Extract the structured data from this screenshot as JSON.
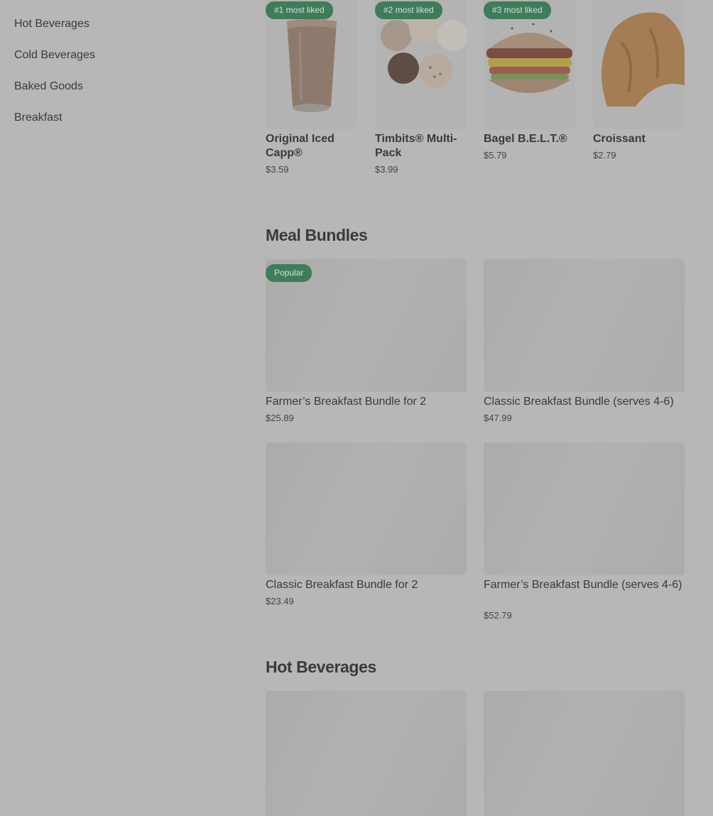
{
  "sidebar": {
    "items": [
      {
        "label": "Hot Beverages"
      },
      {
        "label": "Cold Beverages"
      },
      {
        "label": "Baked Goods"
      },
      {
        "label": "Breakfast"
      }
    ]
  },
  "most_liked": [
    {
      "badge": "#1 most liked",
      "name": "Original Iced Capp®",
      "price": "$3.59",
      "image": "iced-capp-image"
    },
    {
      "badge": "#2 most liked",
      "name": "Timbits® Multi-Pack",
      "price": "$3.99",
      "image": "timbits-image"
    },
    {
      "badge": "#3 most liked",
      "name": "Bagel B.E.L.T.®",
      "price": "$5.79",
      "image": "bagel-belt-image"
    },
    {
      "badge": "",
      "name": "Croissant",
      "price": "$2.79",
      "image": "croissant-image"
    }
  ],
  "meal_bundles": {
    "title": "Meal Bundles",
    "items": [
      {
        "badge": "Popular",
        "name": "Farmer’s Breakfast Bundle for 2",
        "price": "$25.89"
      },
      {
        "badge": "",
        "name": "Classic Breakfast Bundle (serves 4-6)",
        "price": "$47.99"
      },
      {
        "badge": "",
        "name": "Classic Breakfast Bundle for 2",
        "price": "$23.49"
      },
      {
        "badge": "",
        "name": "Farmer’s Breakfast Bundle (serves 4-6)",
        "price": "$52.79"
      }
    ]
  },
  "hot_beverages": {
    "title": "Hot Beverages"
  },
  "colors": {
    "background": "#b7b7b7",
    "badge_bg": "#3f7c5a",
    "text": "#3a3a3a"
  }
}
